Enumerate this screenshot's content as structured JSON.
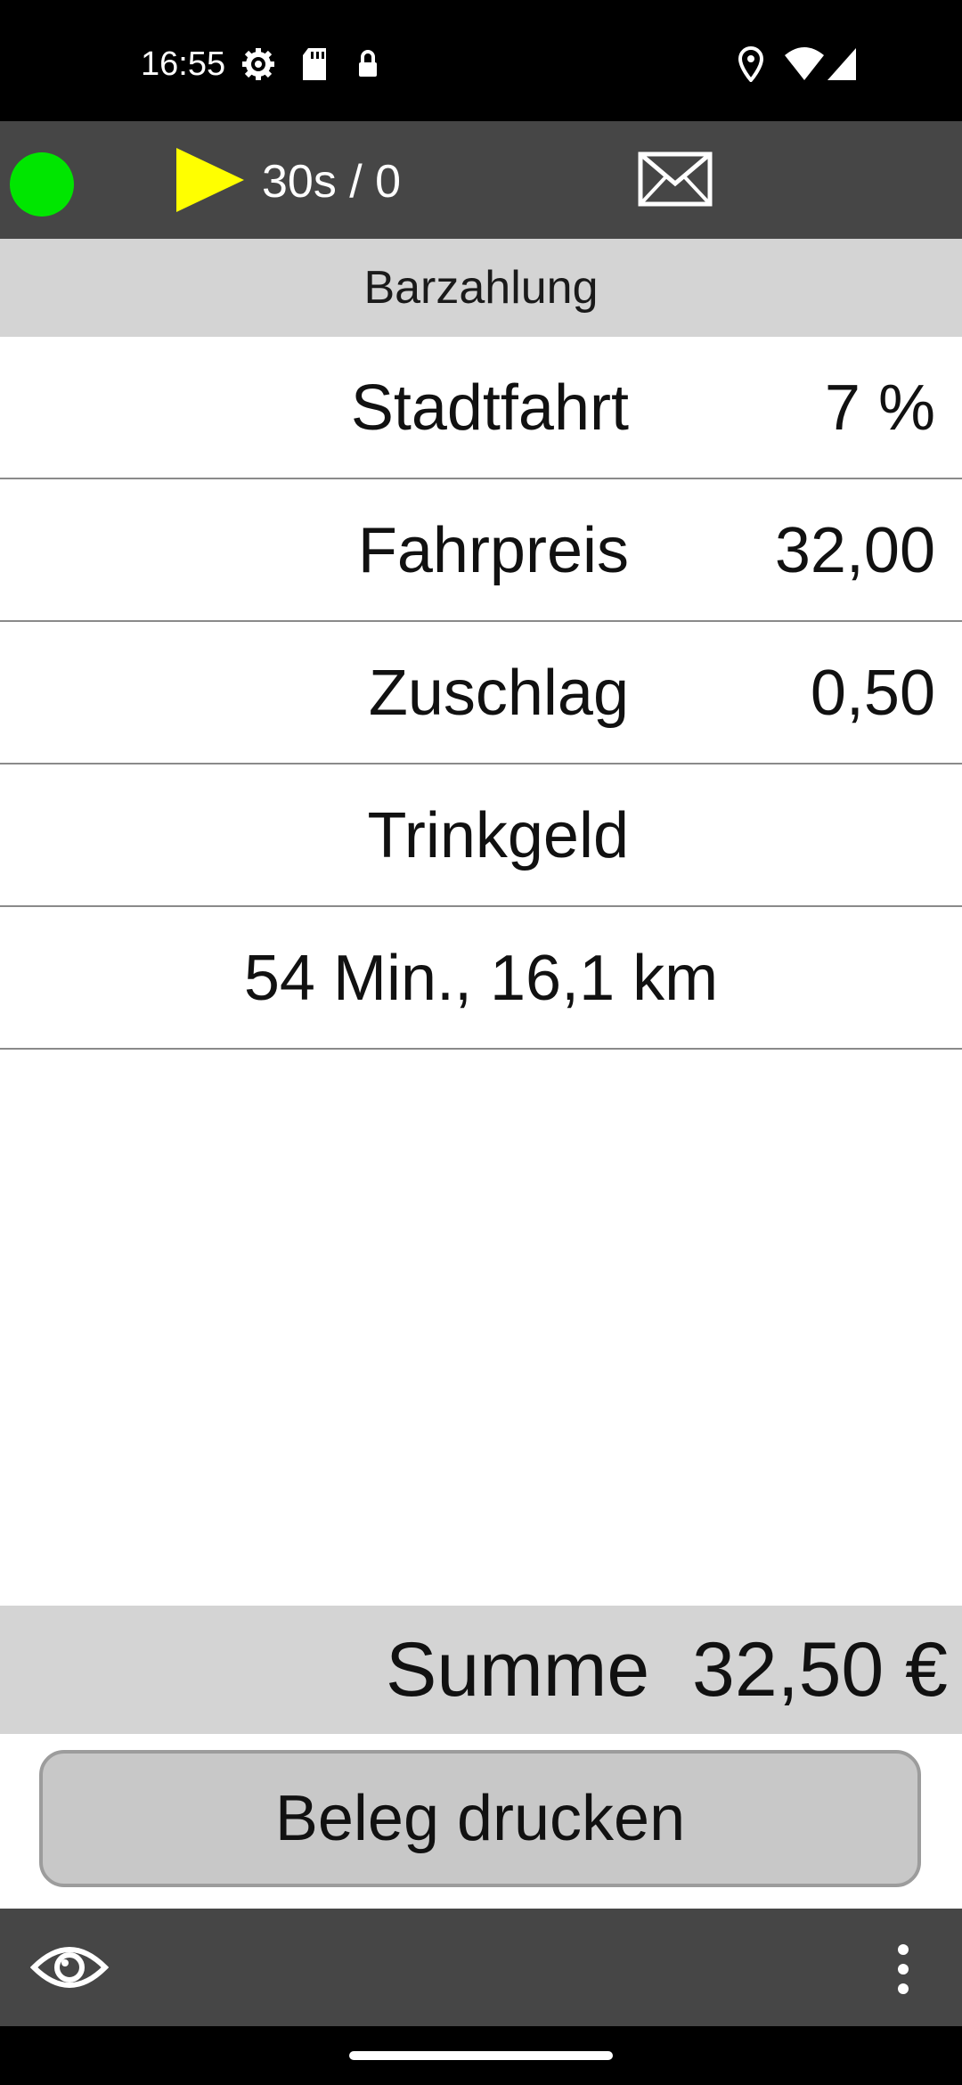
{
  "status_bar": {
    "time": "16:55",
    "icons_left": [
      "gear-icon",
      "sd-card-icon",
      "lock-icon"
    ],
    "icons_right": [
      "location-icon",
      "wifi-icon",
      "signal-icon"
    ]
  },
  "toolbar": {
    "connection_color": "#00e600",
    "play_color": "#ffff00",
    "timer_text": "30s / 0",
    "icons": [
      "status-dot-icon",
      "play-icon",
      "mail-icon"
    ]
  },
  "payment": {
    "header": "Barzahlung",
    "rows": [
      {
        "label": "Stadtfahrt",
        "value": "7 %"
      },
      {
        "label": "Fahrpreis",
        "value": "32,00"
      },
      {
        "label": "Zuschlag",
        "value": "0,50"
      },
      {
        "label": "Trinkgeld",
        "value": ""
      }
    ],
    "trip_info": "54 Min., 16,1 km"
  },
  "total": {
    "text": "Summe  32,50 €"
  },
  "actions": {
    "print_label": "Beleg drucken"
  },
  "bottom_bar": {
    "icons": [
      "eye-icon",
      "more-vert-icon"
    ]
  }
}
